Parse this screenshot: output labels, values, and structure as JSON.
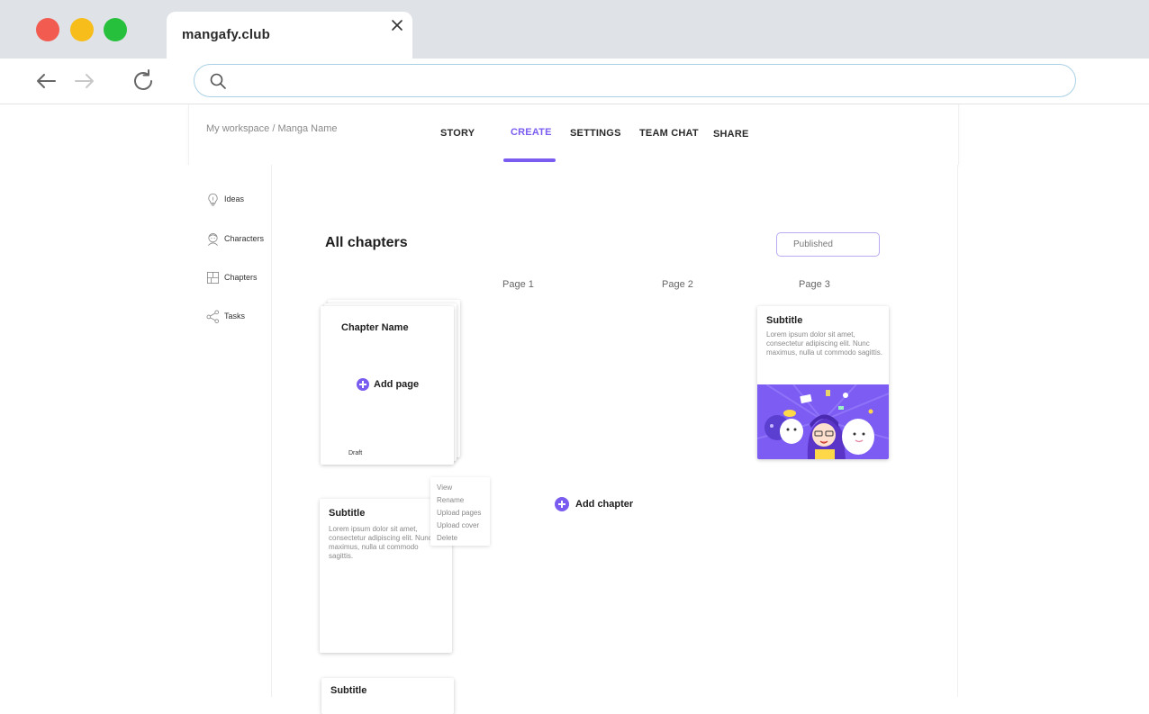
{
  "browser": {
    "tab_title": "mangafy.club",
    "address_value": "",
    "address_placeholder": ""
  },
  "header": {
    "breadcrumb": "My workspace / Manga Name",
    "tabs": [
      {
        "label": "STORY"
      },
      {
        "label": "CREATE",
        "active": true
      },
      {
        "label": "SETTINGS"
      },
      {
        "label": "TEAM CHAT"
      },
      {
        "label": "SHARE"
      }
    ]
  },
  "sidebar": {
    "items": [
      {
        "label": "Ideas",
        "icon": "lightbulb-icon"
      },
      {
        "label": "Characters",
        "icon": "character-icon"
      },
      {
        "label": "Chapters",
        "icon": "chapters-icon"
      },
      {
        "label": "Tasks",
        "icon": "share-nodes-icon"
      }
    ]
  },
  "main": {
    "heading": "All chapters",
    "status_select": "Published",
    "page_labels": [
      "Page 1",
      "Page 2",
      "Page 3"
    ],
    "chapter_card": {
      "name": "Chapter Name",
      "add_page": "Add page",
      "status": "Draft"
    },
    "context_menu": [
      "View",
      "Rename",
      "Upload pages",
      "Upload cover",
      "Delete"
    ],
    "subtitle_card": {
      "title": "Subtitle",
      "text": "Lorem ipsum dolor sit amet, consectetur adipiscing elit. Nunc maximus, nulla ut commodo sagittis."
    },
    "page3_card": {
      "title": "Subtitle",
      "text": "Lorem ipsum dolor sit amet, consectetur adipiscing elit. Nunc maximus, nulla ut commodo sagittis."
    },
    "bottom_card": {
      "title": "Subtitle"
    },
    "add_chapter": "Add chapter"
  },
  "colors": {
    "accent": "#7a5df0",
    "traffic_red": "#f15b50",
    "traffic_yellow": "#f7bd1b",
    "traffic_green": "#27c03d"
  }
}
